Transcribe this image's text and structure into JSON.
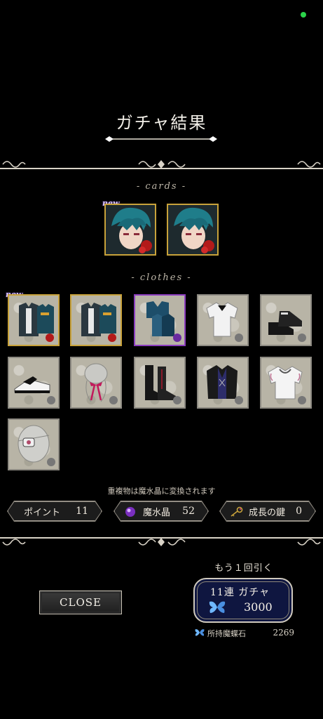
{
  "header": {
    "title": "ガチャ結果"
  },
  "sections": {
    "cards_label": "- cards -",
    "clothes_label": "- clothes -"
  },
  "cards": [
    {
      "name": "blue-haired character card",
      "new_label": "new"
    },
    {
      "name": "blue-haired character card",
      "new_label": ""
    }
  ],
  "clothes": [
    {
      "item": "outfit set",
      "icon": "outfit-icon",
      "new_label": "new",
      "frame": "gold"
    },
    {
      "item": "outfit set",
      "icon": "outfit-icon",
      "new_label": "",
      "frame": "gold"
    },
    {
      "item": "blue jacket set",
      "icon": "jacket-icon",
      "new_label": "",
      "frame": "purple"
    },
    {
      "item": "white shirt",
      "icon": "shirt-icon",
      "new_label": "",
      "frame": "silver"
    },
    {
      "item": "black shoes",
      "icon": "shoes-icon",
      "new_label": "",
      "frame": "silver"
    },
    {
      "item": "white shoes",
      "icon": "shoes-icon",
      "new_label": "",
      "frame": "silver"
    },
    {
      "item": "red ribbon",
      "icon": "ribbon-icon",
      "new_label": "",
      "frame": "silver"
    },
    {
      "item": "laced boots",
      "icon": "boots-icon",
      "new_label": "",
      "frame": "silver"
    },
    {
      "item": "black jacket",
      "icon": "jacket-icon",
      "new_label": "",
      "frame": "silver"
    },
    {
      "item": "frilled shirt",
      "icon": "shirt-icon",
      "new_label": "",
      "frame": "silver"
    },
    {
      "item": "eye patch",
      "icon": "eyepatch-icon",
      "new_label": "",
      "frame": "silver"
    }
  ],
  "note": "重複物は魔水晶に変換されます",
  "currencies": {
    "points": {
      "label": "ポイント",
      "value": "11"
    },
    "crystal": {
      "label": "魔水晶",
      "value": "52"
    },
    "key": {
      "label": "成長の鍵",
      "value": "0"
    }
  },
  "close_button": "CLOSE",
  "gacha": {
    "again_label": "もう１回引く",
    "button_label": "11連 ガチャ",
    "cost": "3000",
    "owned_label": "所持魔蝶石",
    "owned_value": "2269"
  },
  "colors": {
    "frame_gold": "#c8a23a",
    "frame_purple": "#8b3dbf",
    "gacha_bg": "#0f1640",
    "status_dot": "#2bd44a"
  }
}
